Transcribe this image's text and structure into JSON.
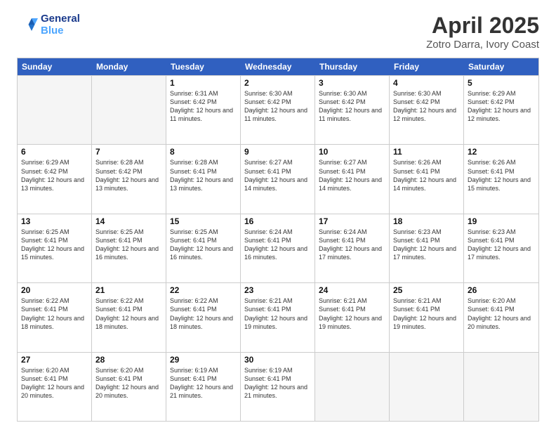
{
  "header": {
    "logo_line1": "General",
    "logo_line2": "Blue",
    "title": "April 2025",
    "subtitle": "Zotro Darra, Ivory Coast"
  },
  "weekdays": [
    "Sunday",
    "Monday",
    "Tuesday",
    "Wednesday",
    "Thursday",
    "Friday",
    "Saturday"
  ],
  "rows": [
    [
      {
        "day": "",
        "text": ""
      },
      {
        "day": "",
        "text": ""
      },
      {
        "day": "1",
        "text": "Sunrise: 6:31 AM\nSunset: 6:42 PM\nDaylight: 12 hours and 11 minutes."
      },
      {
        "day": "2",
        "text": "Sunrise: 6:30 AM\nSunset: 6:42 PM\nDaylight: 12 hours and 11 minutes."
      },
      {
        "day": "3",
        "text": "Sunrise: 6:30 AM\nSunset: 6:42 PM\nDaylight: 12 hours and 11 minutes."
      },
      {
        "day": "4",
        "text": "Sunrise: 6:30 AM\nSunset: 6:42 PM\nDaylight: 12 hours and 12 minutes."
      },
      {
        "day": "5",
        "text": "Sunrise: 6:29 AM\nSunset: 6:42 PM\nDaylight: 12 hours and 12 minutes."
      }
    ],
    [
      {
        "day": "6",
        "text": "Sunrise: 6:29 AM\nSunset: 6:42 PM\nDaylight: 12 hours and 13 minutes."
      },
      {
        "day": "7",
        "text": "Sunrise: 6:28 AM\nSunset: 6:42 PM\nDaylight: 12 hours and 13 minutes."
      },
      {
        "day": "8",
        "text": "Sunrise: 6:28 AM\nSunset: 6:41 PM\nDaylight: 12 hours and 13 minutes."
      },
      {
        "day": "9",
        "text": "Sunrise: 6:27 AM\nSunset: 6:41 PM\nDaylight: 12 hours and 14 minutes."
      },
      {
        "day": "10",
        "text": "Sunrise: 6:27 AM\nSunset: 6:41 PM\nDaylight: 12 hours and 14 minutes."
      },
      {
        "day": "11",
        "text": "Sunrise: 6:26 AM\nSunset: 6:41 PM\nDaylight: 12 hours and 14 minutes."
      },
      {
        "day": "12",
        "text": "Sunrise: 6:26 AM\nSunset: 6:41 PM\nDaylight: 12 hours and 15 minutes."
      }
    ],
    [
      {
        "day": "13",
        "text": "Sunrise: 6:25 AM\nSunset: 6:41 PM\nDaylight: 12 hours and 15 minutes."
      },
      {
        "day": "14",
        "text": "Sunrise: 6:25 AM\nSunset: 6:41 PM\nDaylight: 12 hours and 16 minutes."
      },
      {
        "day": "15",
        "text": "Sunrise: 6:25 AM\nSunset: 6:41 PM\nDaylight: 12 hours and 16 minutes."
      },
      {
        "day": "16",
        "text": "Sunrise: 6:24 AM\nSunset: 6:41 PM\nDaylight: 12 hours and 16 minutes."
      },
      {
        "day": "17",
        "text": "Sunrise: 6:24 AM\nSunset: 6:41 PM\nDaylight: 12 hours and 17 minutes."
      },
      {
        "day": "18",
        "text": "Sunrise: 6:23 AM\nSunset: 6:41 PM\nDaylight: 12 hours and 17 minutes."
      },
      {
        "day": "19",
        "text": "Sunrise: 6:23 AM\nSunset: 6:41 PM\nDaylight: 12 hours and 17 minutes."
      }
    ],
    [
      {
        "day": "20",
        "text": "Sunrise: 6:22 AM\nSunset: 6:41 PM\nDaylight: 12 hours and 18 minutes."
      },
      {
        "day": "21",
        "text": "Sunrise: 6:22 AM\nSunset: 6:41 PM\nDaylight: 12 hours and 18 minutes."
      },
      {
        "day": "22",
        "text": "Sunrise: 6:22 AM\nSunset: 6:41 PM\nDaylight: 12 hours and 18 minutes."
      },
      {
        "day": "23",
        "text": "Sunrise: 6:21 AM\nSunset: 6:41 PM\nDaylight: 12 hours and 19 minutes."
      },
      {
        "day": "24",
        "text": "Sunrise: 6:21 AM\nSunset: 6:41 PM\nDaylight: 12 hours and 19 minutes."
      },
      {
        "day": "25",
        "text": "Sunrise: 6:21 AM\nSunset: 6:41 PM\nDaylight: 12 hours and 19 minutes."
      },
      {
        "day": "26",
        "text": "Sunrise: 6:20 AM\nSunset: 6:41 PM\nDaylight: 12 hours and 20 minutes."
      }
    ],
    [
      {
        "day": "27",
        "text": "Sunrise: 6:20 AM\nSunset: 6:41 PM\nDaylight: 12 hours and 20 minutes."
      },
      {
        "day": "28",
        "text": "Sunrise: 6:20 AM\nSunset: 6:41 PM\nDaylight: 12 hours and 20 minutes."
      },
      {
        "day": "29",
        "text": "Sunrise: 6:19 AM\nSunset: 6:41 PM\nDaylight: 12 hours and 21 minutes."
      },
      {
        "day": "30",
        "text": "Sunrise: 6:19 AM\nSunset: 6:41 PM\nDaylight: 12 hours and 21 minutes."
      },
      {
        "day": "",
        "text": ""
      },
      {
        "day": "",
        "text": ""
      },
      {
        "day": "",
        "text": ""
      }
    ]
  ]
}
